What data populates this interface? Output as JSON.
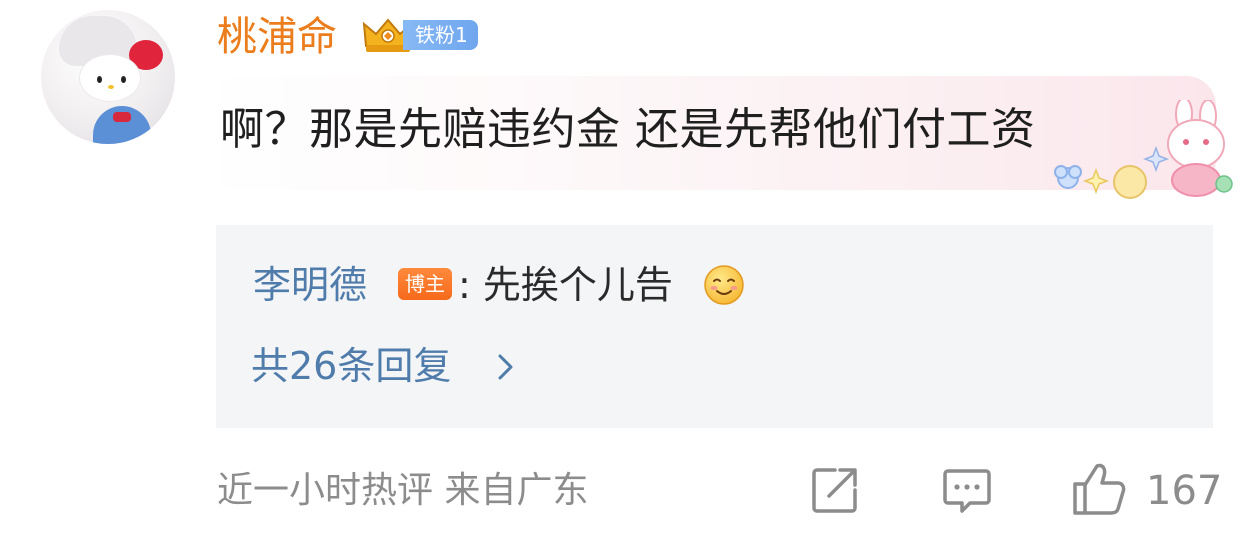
{
  "comment": {
    "username": "桃浦命",
    "fan_badge": "铁粉1",
    "text": "啊？那是先赔违约金 还是先帮他们付工资"
  },
  "reply": {
    "author": "李明德",
    "author_badge": "博主",
    "text": ": 先挨个儿告",
    "more_label": "共26条回复"
  },
  "meta": {
    "time_and_location": "近一小时热评  来自广东"
  },
  "actions": {
    "like_count": "167"
  },
  "icons": {
    "avatar": "hello-kitty-avatar",
    "crown": "crown-icon",
    "sticker": "bunny-sticker",
    "emoji": "smile-emoji-icon",
    "chevron": "chevron-right-icon",
    "share": "share-icon",
    "comment": "comment-icon",
    "like": "like-icon"
  },
  "colors": {
    "username": "#ec7d1c",
    "link_blue": "#4f7cab",
    "fan_badge": "#78aef0",
    "host_badge": "#f6782a",
    "meta_gray": "#8c8c8c"
  }
}
